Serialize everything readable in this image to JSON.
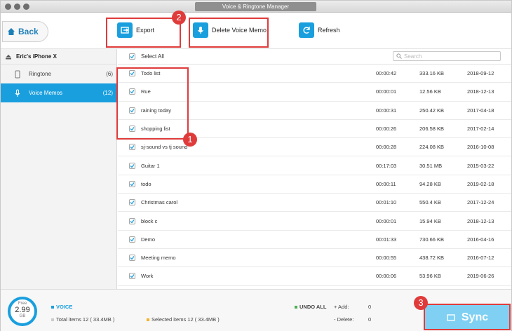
{
  "window": {
    "title": "Voice & Ringtone Manager"
  },
  "toolbar": {
    "back_label": "Back",
    "export_label": "Export",
    "delete_label": "Delete Voice Memo",
    "refresh_label": "Refresh"
  },
  "callouts": {
    "c1": "1",
    "c2": "2",
    "c3": "3"
  },
  "sidebar": {
    "device_name": "Eric's iPhone X",
    "items": [
      {
        "label": "Ringtone",
        "count": "(6)"
      },
      {
        "label": "Voice Memos",
        "count": "(12)"
      }
    ]
  },
  "list": {
    "select_all": "Select All",
    "search_placeholder": "Search",
    "rows": [
      {
        "name": "Todo list",
        "duration": "00:00:42",
        "size": "333.16 KB",
        "date": "2018-09-12"
      },
      {
        "name": "Rue",
        "duration": "00:00:01",
        "size": "12.56 KB",
        "date": "2018-12-13"
      },
      {
        "name": "raining today",
        "duration": "00:00:31",
        "size": "250.42 KB",
        "date": "2017-04-18"
      },
      {
        "name": "shopping list",
        "duration": "00:00:26",
        "size": "206.58 KB",
        "date": "2017-02-14"
      },
      {
        "name": "sj-sound vs tj sound",
        "duration": "00:00:28",
        "size": "224.08 KB",
        "date": "2016-10-08"
      },
      {
        "name": "Guitar 1",
        "duration": "00:17:03",
        "size": "30.51 MB",
        "date": "2015-03-22"
      },
      {
        "name": "todo",
        "duration": "00:00:11",
        "size": "94.28 KB",
        "date": "2019-02-18"
      },
      {
        "name": "Christmas carol",
        "duration": "00:01:10",
        "size": "550.4 KB",
        "date": "2017-12-24"
      },
      {
        "name": "block c",
        "duration": "00:00:01",
        "size": "15.94 KB",
        "date": "2018-12-13"
      },
      {
        "name": "Demo",
        "duration": "00:01:33",
        "size": "730.66 KB",
        "date": "2016-04-16"
      },
      {
        "name": "Meeting memo",
        "duration": "00:00:55",
        "size": "438.72 KB",
        "date": "2016-07-12"
      },
      {
        "name": "Work",
        "duration": "00:00:06",
        "size": "53.96 KB",
        "date": "2019-06-26"
      }
    ]
  },
  "footer": {
    "free_label": "Free",
    "free_value": "2.99",
    "free_unit": "GB",
    "voice_label": "VOICE",
    "total_items": "Total items 12 ( 33.4MB )",
    "selected_items": "Selected items 12 ( 33.4MB )",
    "undo_all": "UNDO ALL",
    "add_label": "+ Add:",
    "add_value": "0",
    "delete_label": "- Delete:",
    "delete_value": "0",
    "sync_label": "Sync"
  },
  "colors": {
    "accent": "#1a9fde",
    "callout": "#e03b3b",
    "sync": "#7fd0f2"
  }
}
